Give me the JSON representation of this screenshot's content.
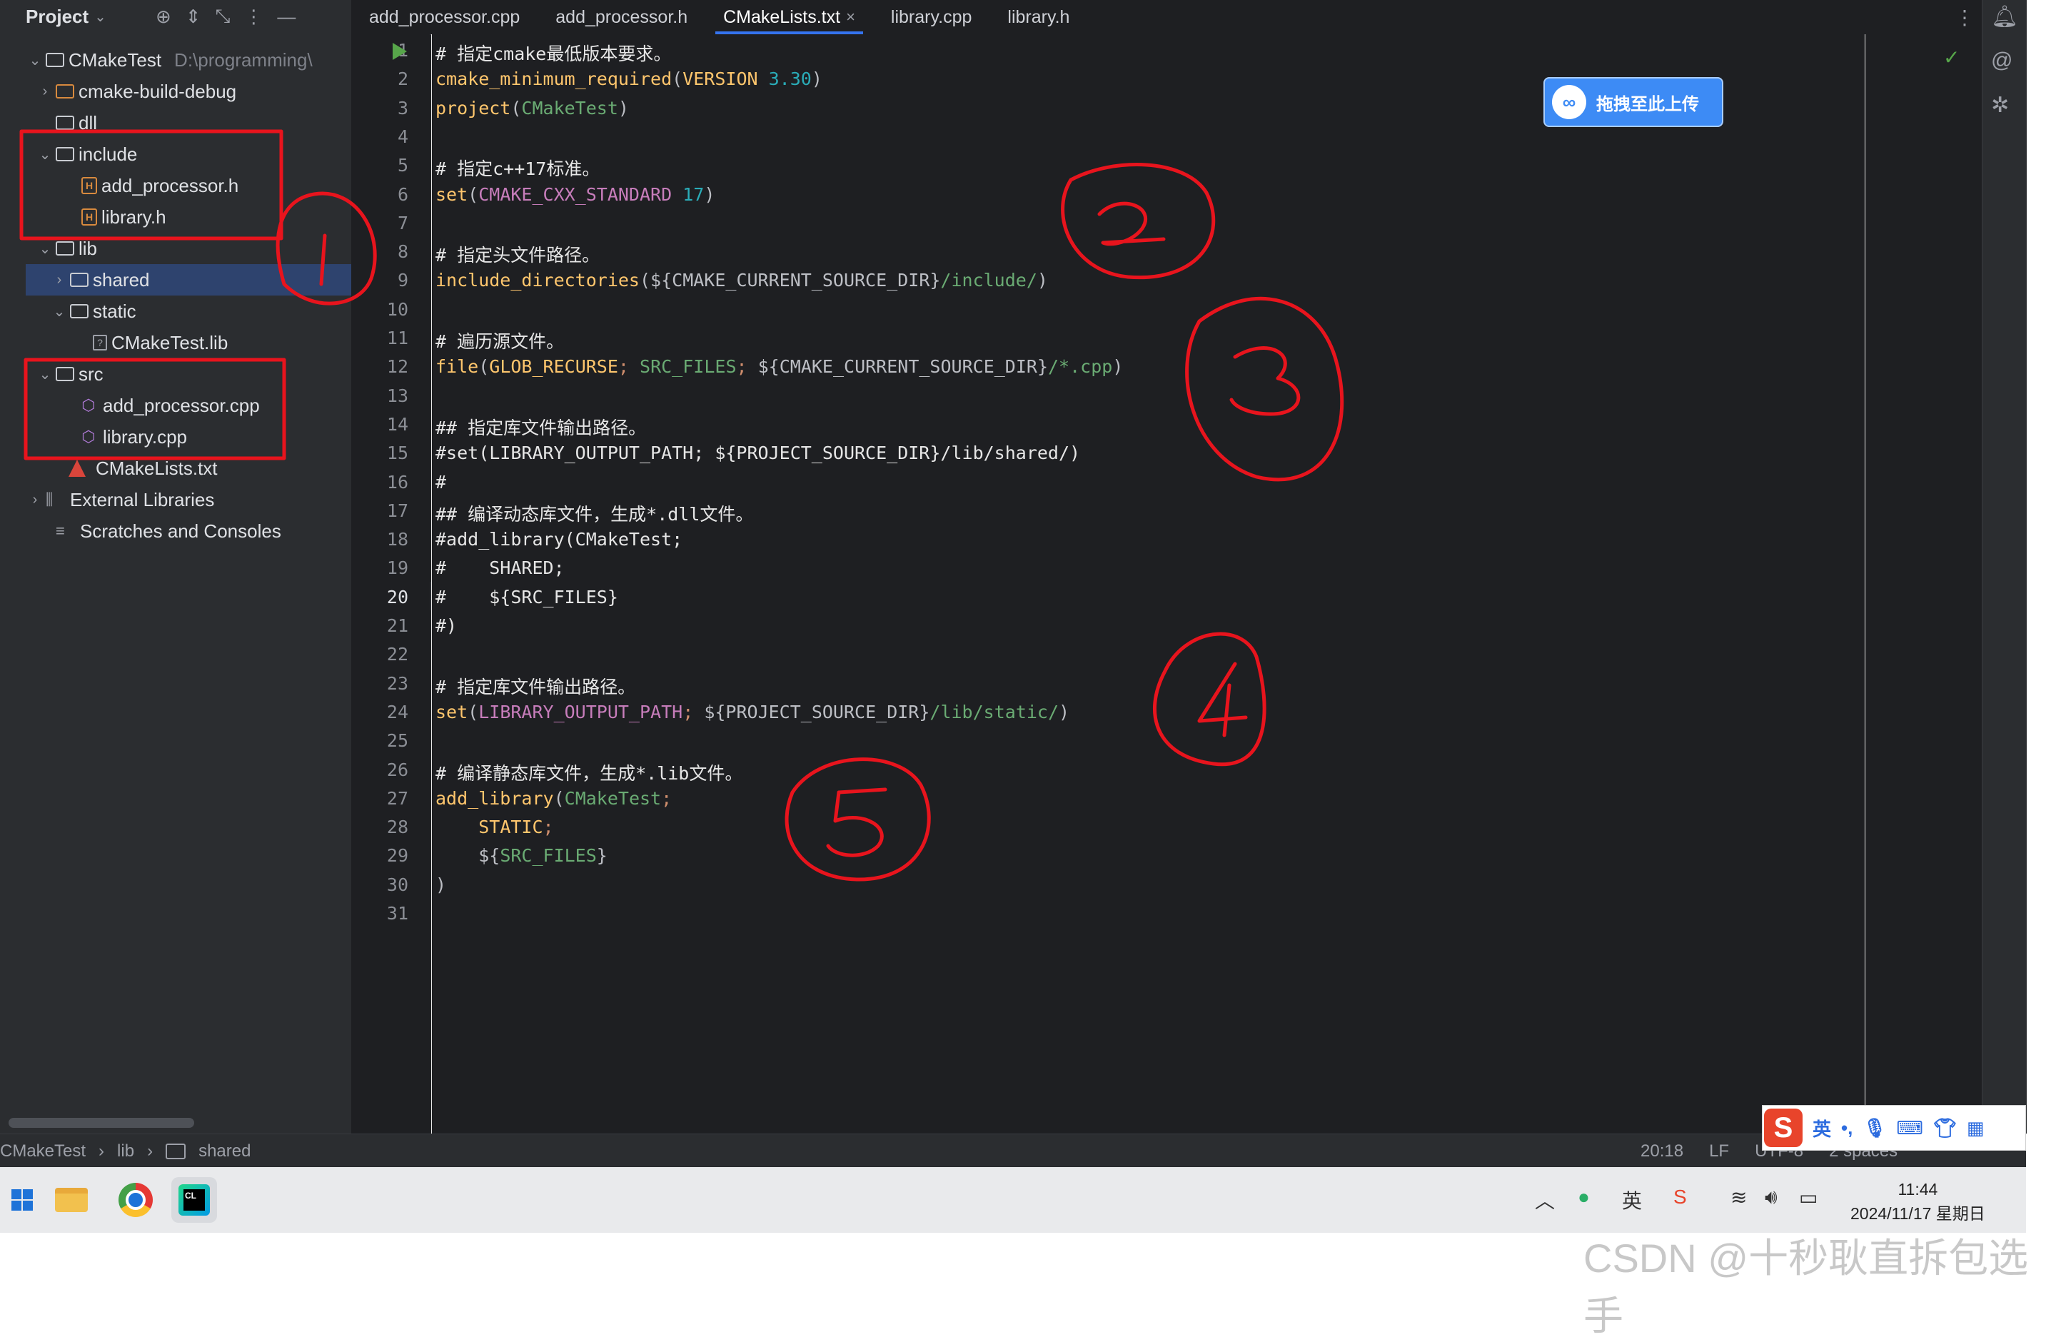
{
  "project_panel": {
    "title": "Project",
    "tree": [
      {
        "label": "CMakeTest",
        "path": "D:\\programming\\",
        "kind": "root"
      },
      {
        "label": "cmake-build-debug",
        "kind": "folder"
      },
      {
        "label": "dll",
        "kind": "folder"
      },
      {
        "label": "include",
        "kind": "folder"
      },
      {
        "label": "add_processor.h",
        "kind": "header"
      },
      {
        "label": "library.h",
        "kind": "header"
      },
      {
        "label": "lib",
        "kind": "folder"
      },
      {
        "label": "shared",
        "kind": "folder",
        "selected": true
      },
      {
        "label": "static",
        "kind": "folder"
      },
      {
        "label": "CMakeTest.lib",
        "kind": "lib"
      },
      {
        "label": "src",
        "kind": "folder"
      },
      {
        "label": "add_processor.cpp",
        "kind": "cpp"
      },
      {
        "label": "library.cpp",
        "kind": "cpp"
      },
      {
        "label": "CMakeLists.txt",
        "kind": "cmake"
      },
      {
        "label": "External Libraries",
        "kind": "extlib"
      },
      {
        "label": "Scratches and Consoles",
        "kind": "scratch"
      }
    ]
  },
  "tabs": [
    "add_processor.cpp",
    "add_processor.h",
    "CMakeLists.txt",
    "library.cpp",
    "library.h"
  ],
  "active_tab": "CMakeLists.txt",
  "upload_label": "拖拽至此上传",
  "code_lines": [
    "# 指定cmake最低版本要求。",
    "cmake_minimum_required(VERSION 3.30)",
    "project(CMakeTest)",
    "",
    "# 指定c++17标准。",
    "set(CMAKE_CXX_STANDARD 17)",
    "",
    "# 指定头文件路径。",
    "include_directories(${CMAKE_CURRENT_SOURCE_DIR}/include/)",
    "",
    "# 遍历源文件。",
    "file(GLOB_RECURSE; SRC_FILES; ${CMAKE_CURRENT_SOURCE_DIR}/*.cpp)",
    "",
    "## 指定库文件输出路径。",
    "#set(LIBRARY_OUTPUT_PATH; ${PROJECT_SOURCE_DIR}/lib/shared/)",
    "#",
    "## 编译动态库文件，生成*.dll文件。",
    "#add_library(CMakeTest;",
    "#    SHARED;",
    "#    ${SRC_FILES}",
    "#)",
    "",
    "# 指定库文件输出路径。",
    "set(LIBRARY_OUTPUT_PATH; ${PROJECT_SOURCE_DIR}/lib/static/)",
    "",
    "# 编译静态库文件，生成*.lib文件。",
    "add_library(CMakeTest;",
    "    STATIC;",
    "    ${SRC_FILES}",
    ")",
    ""
  ],
  "current_line": 20,
  "status": {
    "breadcrumb": [
      "CMakeTest",
      "lib",
      "shared"
    ],
    "position": "20:18",
    "line_ending": "LF",
    "encoding": "UTF-8",
    "indent": "2 spaces"
  },
  "ime": {
    "logo": "S",
    "lang": "英"
  },
  "clock": {
    "time": "11:44",
    "date": "2024/11/17 星期日"
  },
  "watermark": "CSDN @十秒耿直拆包选手",
  "annotations": [
    "1",
    "2",
    "3",
    "4",
    "5"
  ]
}
